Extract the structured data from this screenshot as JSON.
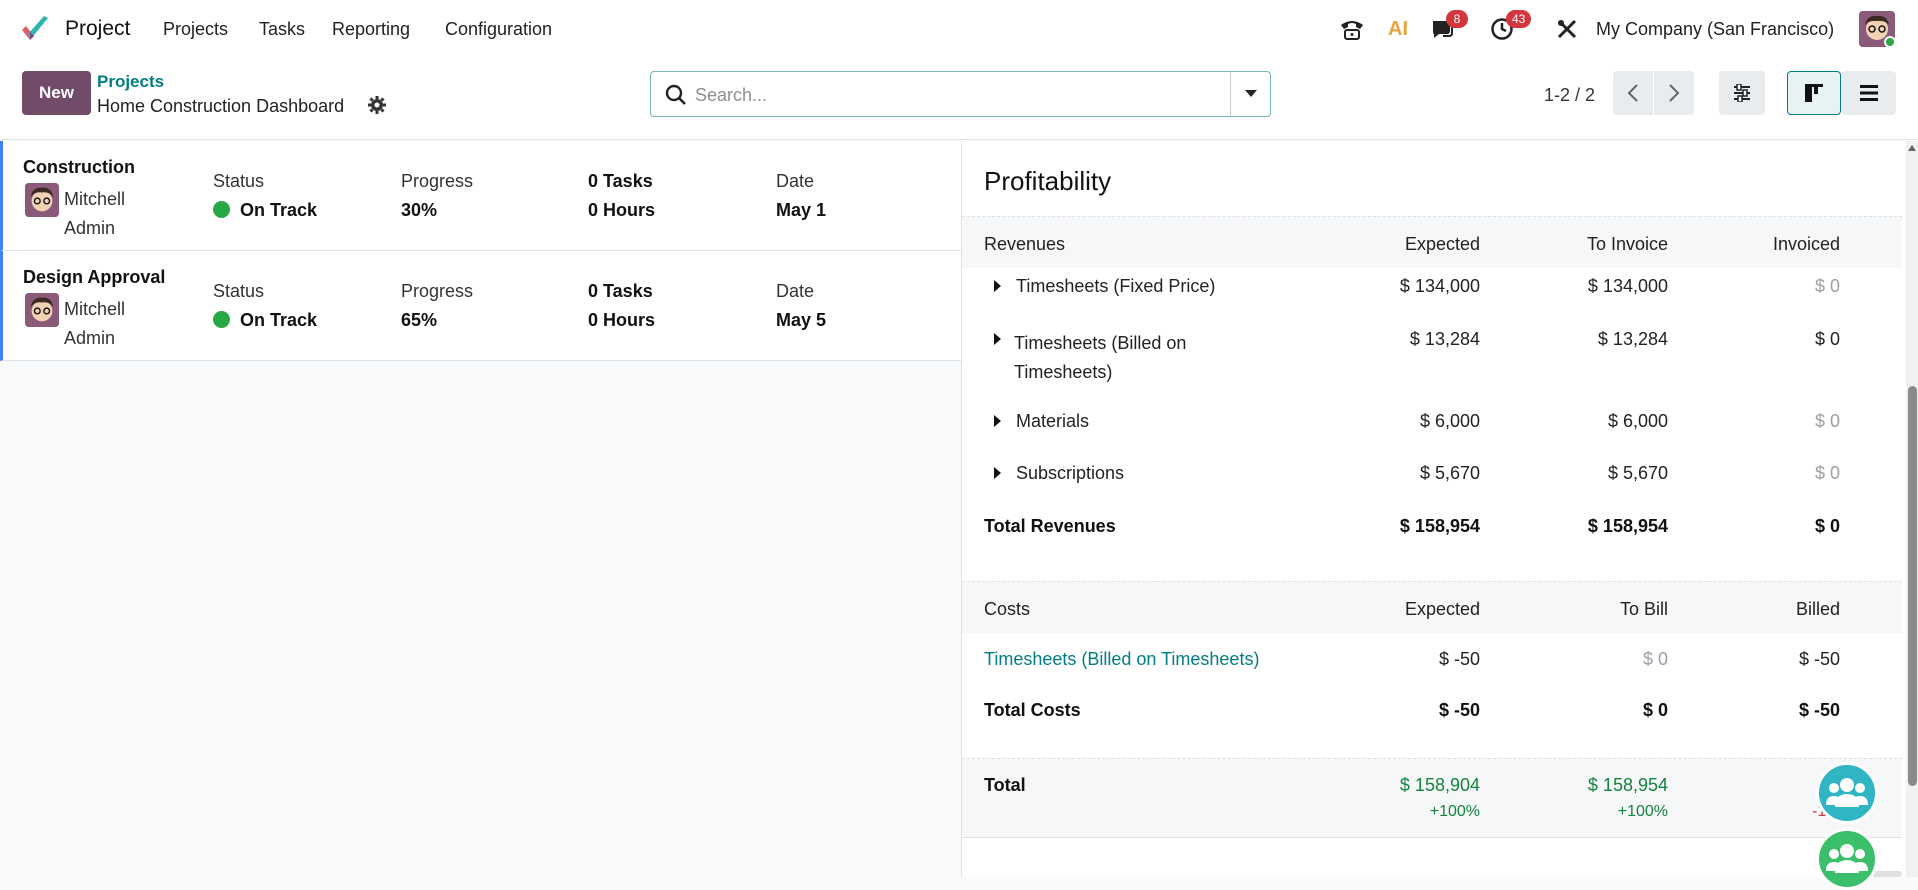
{
  "navbar": {
    "app_name": "Project",
    "menu": [
      "Projects",
      "Tasks",
      "Reporting",
      "Configuration"
    ],
    "messages_badge": "8",
    "activities_badge": "43",
    "ai_label": "AI",
    "company": "My Company (San Francisco)"
  },
  "control": {
    "new_label": "New",
    "breadcrumb_parent": "Projects",
    "breadcrumb_current": "Home Construction Dashboard",
    "search_placeholder": "Search...",
    "pager": "1-2 / 2"
  },
  "records": [
    {
      "title": "Construction",
      "user_first": "Mitchell",
      "user_last": "Admin",
      "status_label": "Status",
      "status": "On Track",
      "progress_label": "Progress",
      "progress": "30%",
      "tasks": "0 Tasks",
      "hours": "0 Hours",
      "date_label": "Date",
      "date": "May 1"
    },
    {
      "title": "Design Approval",
      "user_first": "Mitchell",
      "user_last": "Admin",
      "status_label": "Status",
      "status": "On Track",
      "progress_label": "Progress",
      "progress": "65%",
      "tasks": "0 Tasks",
      "hours": "0 Hours",
      "date_label": "Date",
      "date": "May 5"
    }
  ],
  "profitability": {
    "title": "Profitability",
    "revenues_header": [
      "Revenues",
      "Expected",
      "To Invoice",
      "Invoiced"
    ],
    "revenues": [
      {
        "name": "Timesheets (Fixed Price)",
        "name2": "",
        "expected": "$ 134,000",
        "to_invoice": "$ 134,000",
        "invoiced": "$ 0"
      },
      {
        "name": "Timesheets (Billed on",
        "name2": "Timesheets)",
        "expected": "$ 13,284",
        "to_invoice": "$ 13,284",
        "invoiced": "$ 0"
      },
      {
        "name": "Materials",
        "name2": "",
        "expected": "$ 6,000",
        "to_invoice": "$ 6,000",
        "invoiced": "$ 0"
      },
      {
        "name": "Subscriptions",
        "name2": "",
        "expected": "$ 5,670",
        "to_invoice": "$ 5,670",
        "invoiced": "$ 0"
      }
    ],
    "total_revenues": {
      "label": "Total Revenues",
      "expected": "$ 158,954",
      "to_invoice": "$ 158,954",
      "invoiced": "$ 0"
    },
    "costs_header": [
      "Costs",
      "Expected",
      "To Bill",
      "Billed"
    ],
    "costs": [
      {
        "name": "Timesheets (Billed on Timesheets)",
        "expected": "$ -50",
        "to_bill": "$ 0",
        "billed": "$ -50"
      }
    ],
    "total_costs": {
      "label": "Total Costs",
      "expected": "$ -50",
      "to_bill": "$ 0",
      "billed": "$ -50"
    },
    "total": {
      "label": "Total",
      "expected": "$ 158,904",
      "expected_pct": "+100%",
      "to_invoice": "$ 158,954",
      "to_invoice_pct": "+100%",
      "billed_pct": "-1"
    }
  },
  "colors": {
    "brand": "#714b67",
    "link": "#017e84",
    "success": "#28a745",
    "badge": "#d4363f"
  }
}
